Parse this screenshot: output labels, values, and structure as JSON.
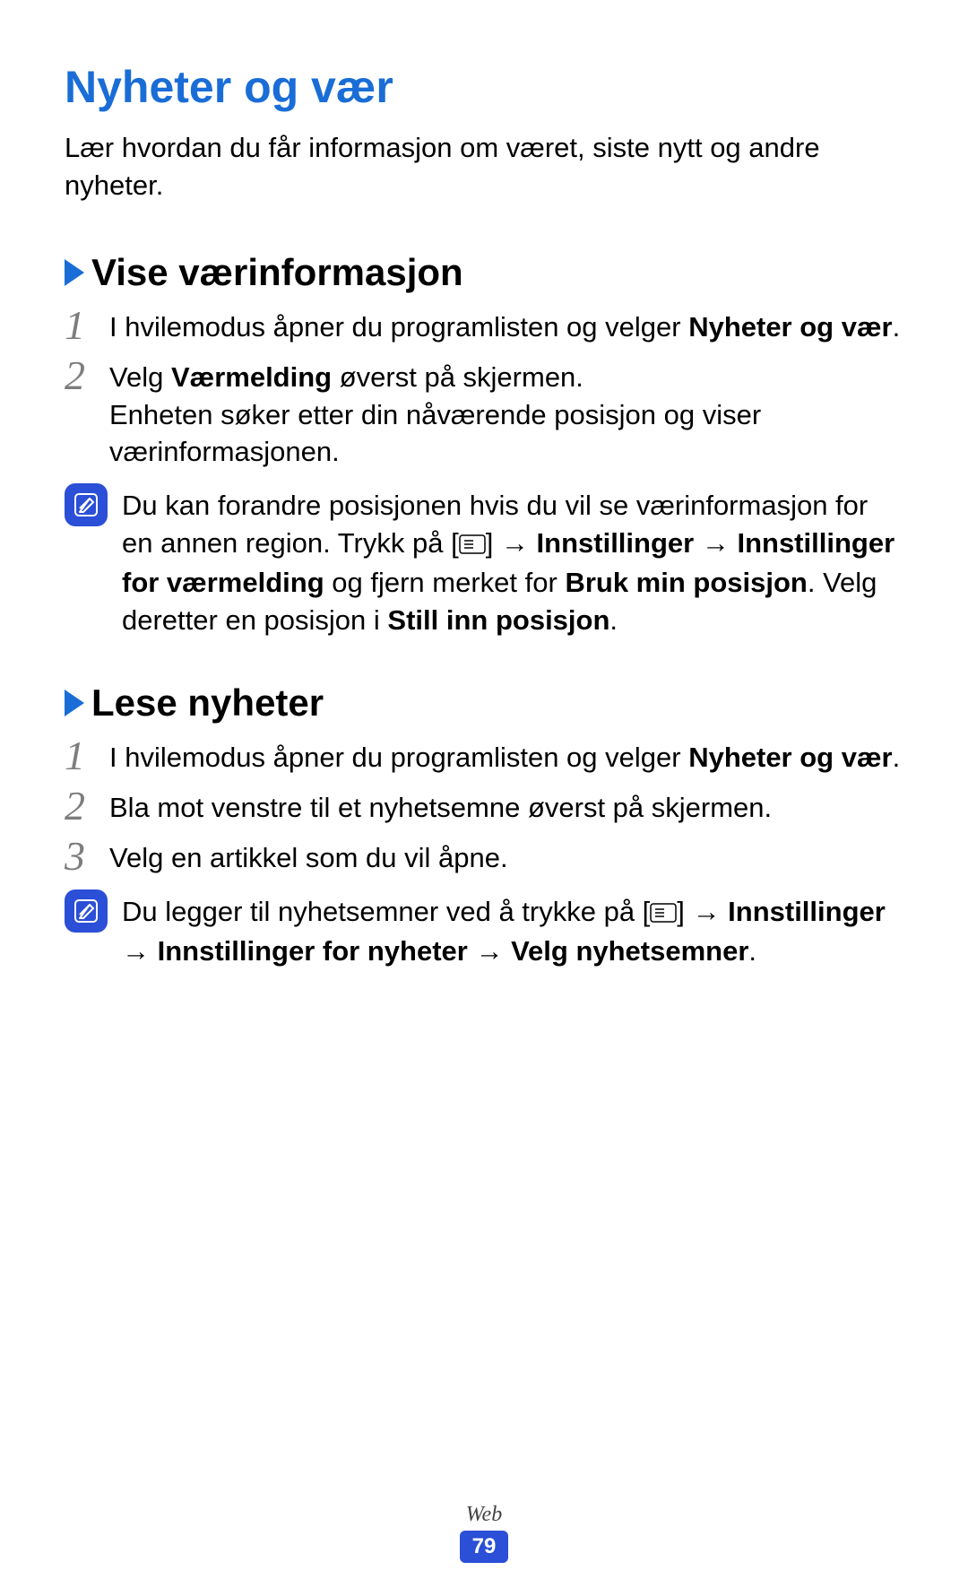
{
  "title": "Nyheter og vær",
  "intro": "Lær hvordan du får informasjon om været, siste nytt og andre nyheter.",
  "section1": {
    "heading": "Vise værinformasjon",
    "step1": {
      "num": "1",
      "text_before": "I hvilemodus åpner du programlisten og velger ",
      "bold": "Nyheter og vær",
      "text_after": "."
    },
    "step2": {
      "num": "2",
      "line1_before": "Velg ",
      "line1_bold": "Værmelding",
      "line1_after": " øverst på skjermen.",
      "line2": "Enheten søker etter din nåværende posisjon og viser værinformasjonen."
    },
    "note": {
      "part1": "Du kan forandre posisjonen hvis du vil se værinformasjon for en annen region. Trykk på [",
      "part2": "] → ",
      "bold1": "Innstillinger",
      "part3": " → ",
      "bold2": "Innstillinger for værmelding",
      "part4": " og fjern merket for ",
      "bold3": "Bruk min posisjon",
      "part5": ". Velg deretter en posisjon i ",
      "bold4": "Still inn posisjon",
      "part6": "."
    }
  },
  "section2": {
    "heading": "Lese nyheter",
    "step1": {
      "num": "1",
      "text_before": "I hvilemodus åpner du programlisten og velger ",
      "bold": "Nyheter og vær",
      "text_after": "."
    },
    "step2": {
      "num": "2",
      "text": "Bla mot venstre til et nyhetsemne øverst på skjermen."
    },
    "step3": {
      "num": "3",
      "text": "Velg en artikkel som du vil åpne."
    },
    "note": {
      "part1": "Du legger til nyhetsemner ved å trykke på [",
      "part2": "] → ",
      "bold1": "Innstillinger",
      "part3": " → ",
      "bold2": "Innstillinger for nyheter",
      "part4": " → ",
      "bold3": "Velg nyhetsemner",
      "part5": "."
    }
  },
  "footer": {
    "category": "Web",
    "page": "79"
  }
}
